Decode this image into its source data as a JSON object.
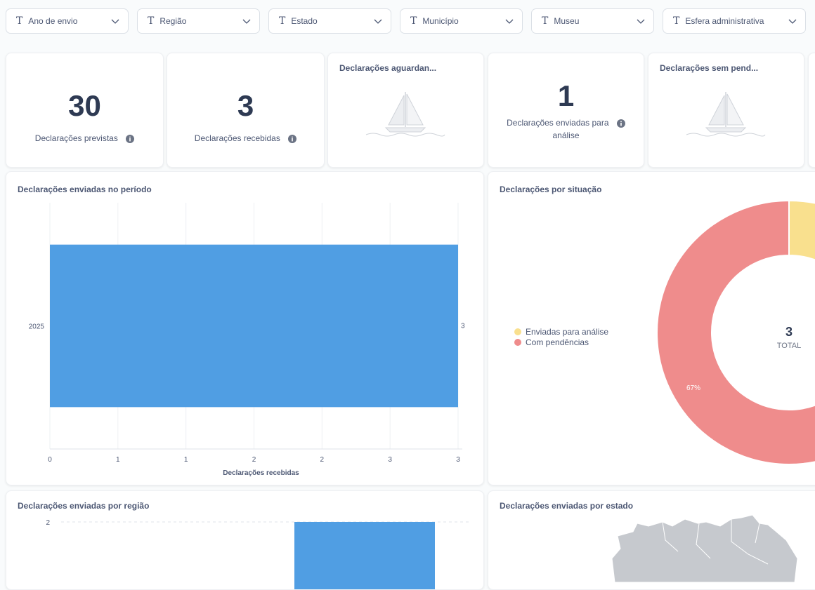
{
  "filters": [
    {
      "label": "Ano de envio"
    },
    {
      "label": "Região"
    },
    {
      "label": "Estado"
    },
    {
      "label": "Município"
    },
    {
      "label": "Museu"
    },
    {
      "label": "Esfera administrativa"
    }
  ],
  "scalars": {
    "previstas": {
      "value": "30",
      "label": "Declarações previstas"
    },
    "recebidas": {
      "value": "3",
      "label": "Declarações recebidas"
    },
    "aguardando": {
      "title": "Declarações aguardan..."
    },
    "enviadas_analise": {
      "value": "1",
      "label_line1": "Declarações enviadas para",
      "label_line2": "análise"
    },
    "sem_pendencias": {
      "title": "Declarações sem pend..."
    }
  },
  "periodo": {
    "title": "Declarações enviadas no período",
    "xlabel": "Declarações recebidas",
    "value_label": "3"
  },
  "situacao": {
    "title": "Declarações por situação",
    "legend": [
      "Enviadas para análise",
      "Com pendências"
    ],
    "total_value": "3",
    "total_label": "TOTAL",
    "slice_label": "67%"
  },
  "regiao": {
    "title": "Declarações enviadas por região"
  },
  "estado": {
    "title": "Declarações enviadas por estado"
  },
  "colors": {
    "bar": "#509ee3",
    "slice_yellow": "#f9e08e",
    "slice_red": "#ef8c8c",
    "map_gray": "#c6c9ce"
  },
  "chart_data": [
    {
      "type": "bar",
      "orientation": "horizontal",
      "title": "Declarações enviadas no período",
      "categories": [
        "2025"
      ],
      "values": [
        3
      ],
      "xlabel": "Declarações recebidas",
      "xticks": [
        "0",
        "1",
        "1",
        "2",
        "2",
        "3",
        "3"
      ],
      "xlim": [
        0,
        3
      ],
      "grid": true
    },
    {
      "type": "pie",
      "title": "Declarações por situação",
      "labels": [
        "Enviadas para análise",
        "Com pendências"
      ],
      "values": [
        1,
        2
      ],
      "total": 3,
      "legend": "left"
    },
    {
      "type": "bar",
      "title": "Declarações enviadas por região",
      "yticks": [
        "2"
      ],
      "visible_values": [
        2
      ]
    }
  ]
}
